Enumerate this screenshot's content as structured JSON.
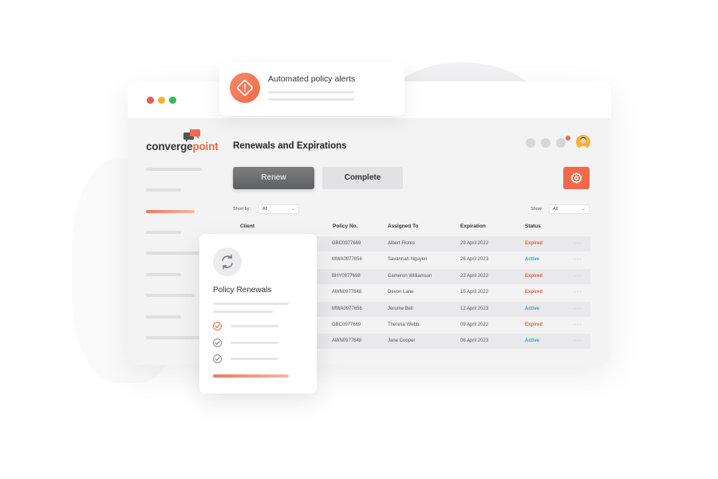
{
  "app": {
    "logo_part1": "converge",
    "logo_part2": "point",
    "accent_color": "#ef6a4a"
  },
  "header": {
    "title": "Renewals and Expirations"
  },
  "toolbar": {
    "renew_label": "Renew",
    "complete_label": "Complete",
    "settings_icon": "gear-icon"
  },
  "filters": {
    "sort_label": "Short by:",
    "sort_value": "All",
    "show_label": "Show:",
    "show_value": "All"
  },
  "table": {
    "columns": [
      "Client",
      "Policy No.",
      "Assigned To",
      "Expiration",
      "Status"
    ],
    "rows": [
      {
        "policy": "GBC0977669",
        "assigned": "Albert Flores",
        "expiration": "29 April 2022",
        "status": "Expired"
      },
      {
        "policy": "MWA0977656",
        "assigned": "Savannah Nguyen",
        "expiration": "26 April 2023",
        "status": "Active"
      },
      {
        "policy": "BHY0977698",
        "assigned": "Cameron Williamson",
        "expiration": "23 April 2022",
        "status": "Expired"
      },
      {
        "policy": "AWN0977648",
        "assigned": "Devon Lane",
        "expiration": "15 April 2022",
        "status": "Expired"
      },
      {
        "policy": "MWA0977656",
        "assigned": "Jerome Bell",
        "expiration": "12 April 2023",
        "status": "Active"
      },
      {
        "policy": "GBC0977669",
        "assigned": "Theresa Webb",
        "expiration": "09 April 2022",
        "status": "Expired"
      },
      {
        "policy": "AWN0977648",
        "assigned": "Jane Cooper",
        "expiration": "06 April 2023",
        "status": "Active"
      }
    ],
    "row_menu": "···"
  },
  "alert_card": {
    "title": "Automated policy alerts",
    "icon": "alert-diamond-icon"
  },
  "renewals_card": {
    "title": "Policy Renewals",
    "icon": "refresh-icon"
  },
  "colors": {
    "expired": "#e85a3a",
    "active": "#2ea3c7"
  }
}
